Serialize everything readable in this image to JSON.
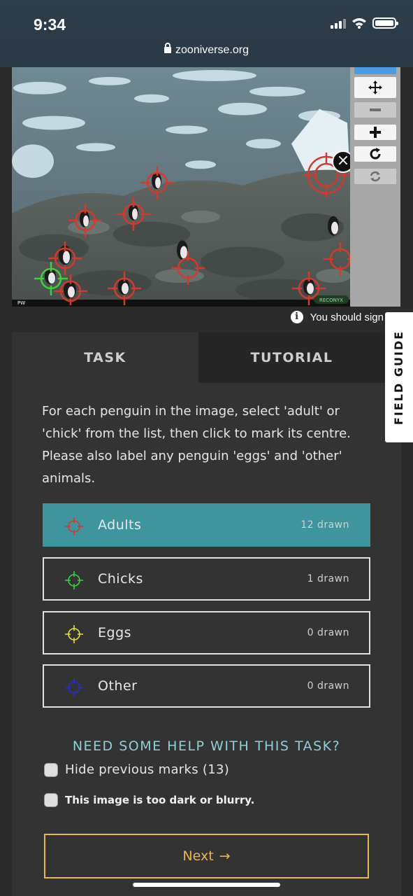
{
  "status_bar": {
    "time": "9:34"
  },
  "browser": {
    "url": "zooniverse.org"
  },
  "subject": {
    "image_label": "PW",
    "camera_brand": "RECONYX",
    "sign_in_note": "You should sign"
  },
  "toolbar": {
    "icons": [
      "pointer-icon",
      "move-icon",
      "zoom-out-icon",
      "zoom-in-icon",
      "rotate-icon",
      "reset-icon"
    ]
  },
  "field_guide": {
    "label": "FIELD GUIDE"
  },
  "tabs": [
    {
      "label": "TASK",
      "active": true
    },
    {
      "label": "TUTORIAL",
      "active": false
    }
  ],
  "task": {
    "instructions": "For each penguin in the image, select 'adult' or 'chick' from the list, then click to mark its centre. Please also label any penguin 'eggs' and 'other' animals.",
    "answers": [
      {
        "label": "Adults",
        "count": "12 drawn",
        "color": "#d33a2c",
        "selected": true
      },
      {
        "label": "Chicks",
        "count": "1 drawn",
        "color": "#3bd33b",
        "selected": false
      },
      {
        "label": "Eggs",
        "count": "0 drawn",
        "color": "#e8e22c",
        "selected": false
      },
      {
        "label": "Other",
        "count": "0 drawn",
        "color": "#2a2ad3",
        "selected": false
      }
    ],
    "help_label": "NEED SOME HELP WITH THIS TASK?",
    "hide_marks_label": "Hide previous marks (13)",
    "too_dark_label": "This image is too dark or blurry.",
    "next_label": "Next",
    "next_arrow": "→"
  },
  "colors": {
    "accent": "#3f959e",
    "next": "#e8b84a",
    "mark_adult": "#d33a2c",
    "mark_chick": "#3bd33b"
  }
}
